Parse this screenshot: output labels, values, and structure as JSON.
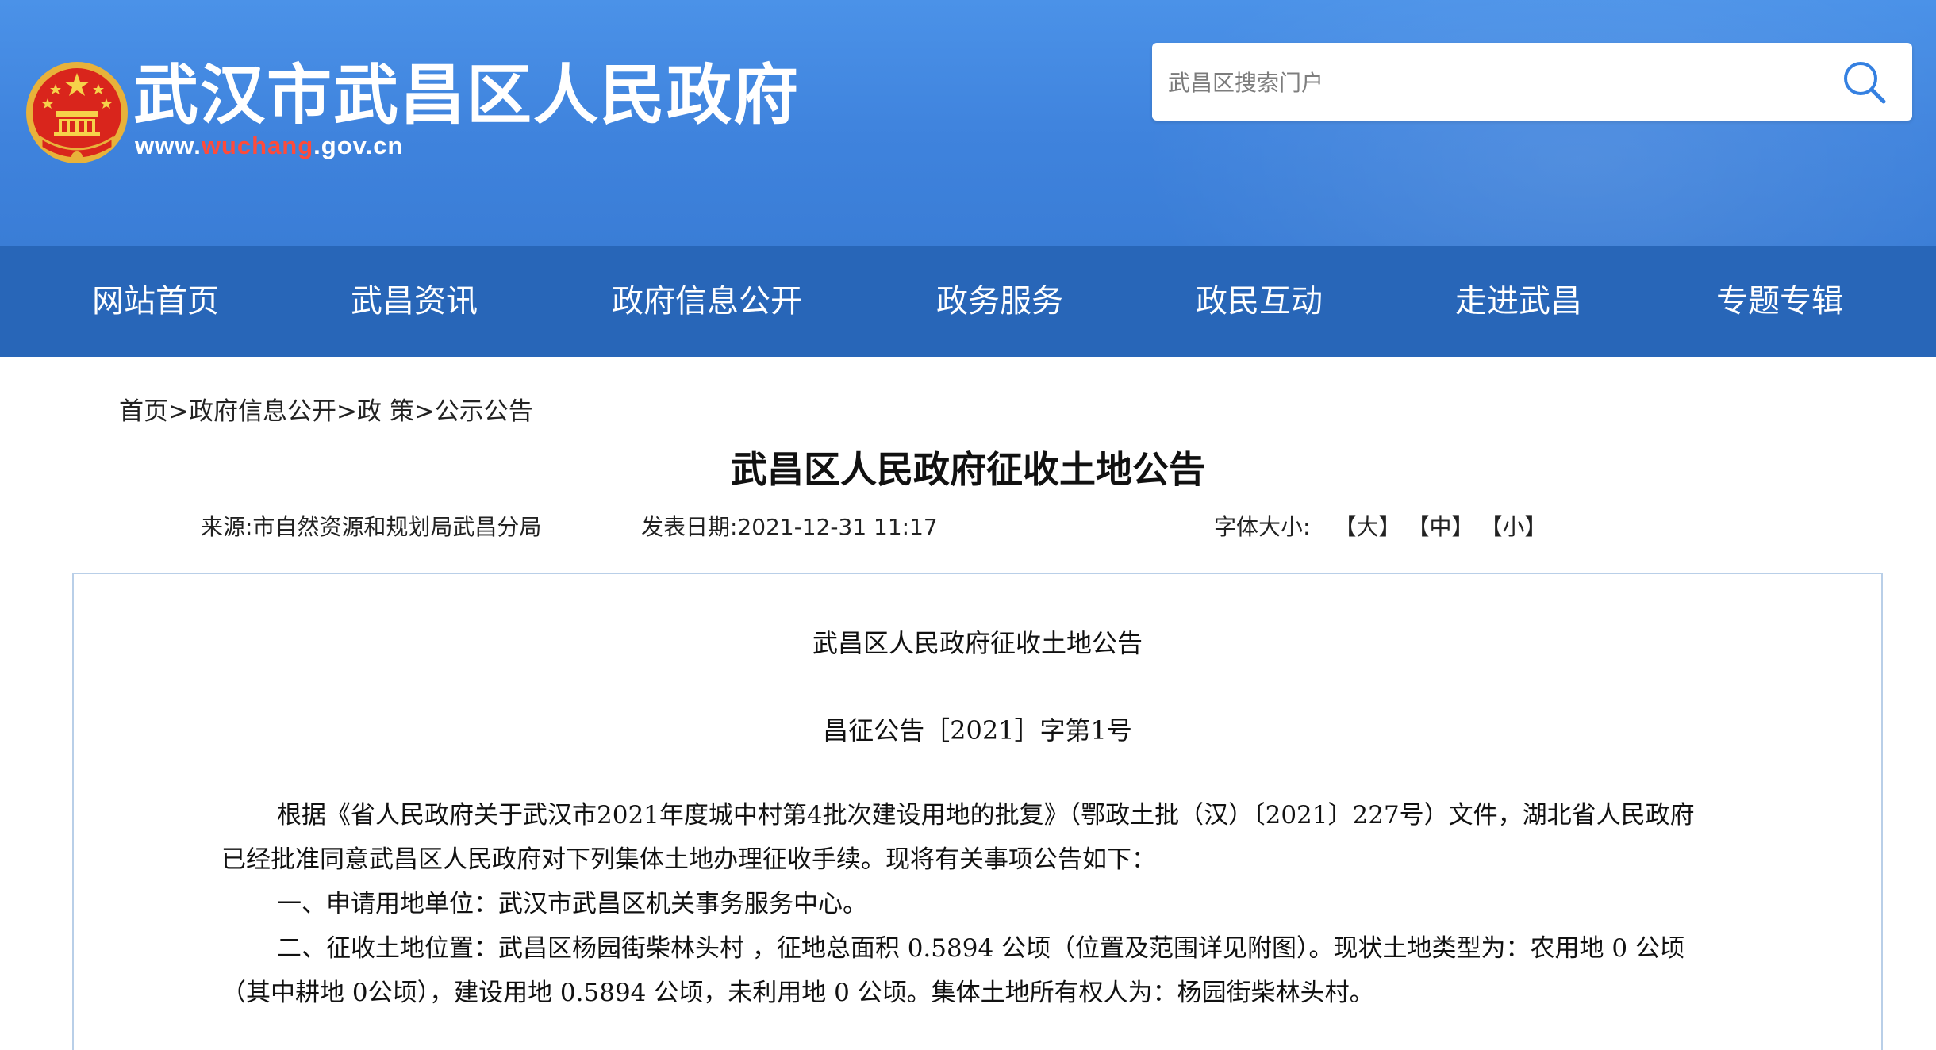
{
  "header": {
    "site_title": "武汉市武昌区人民政府",
    "url_prefix": "www.",
    "url_highlight": "wuchang",
    "url_suffix": ".gov.cn",
    "search_placeholder": "武昌区搜索门户",
    "colors": {
      "banner": "#3f83dd",
      "nav": "#2866b8",
      "url_accent": "#ff4b3a"
    }
  },
  "nav": {
    "items": [
      "网站首页",
      "武昌资讯",
      "政府信息公开",
      "政务服务",
      "政民互动",
      "走进武昌",
      "专题专辑"
    ]
  },
  "breadcrumb": {
    "items": [
      "首页",
      "政府信息公开",
      "政 策",
      "公示公告"
    ],
    "separator": ">"
  },
  "article": {
    "title": "武昌区人民政府征收土地公告",
    "source": "来源:市自然资源和规划局武昌分局",
    "date": "发表日期:2021-12-31 11:17",
    "font_size_label": "字体大小:",
    "font_sizes": [
      "【大】",
      "【中】",
      "【小】"
    ]
  },
  "document": {
    "title": "武昌区人民政府征收土地公告",
    "number": "昌征公告［2021］字第1号",
    "lines": [
      "根据《省人民政府关于武汉市2021年度城中村第4批次建设用地的批复》（鄂政土批（汉）〔2021〕227号）文件，湖北省人民政府",
      "已经批准同意武昌区人民政府对下列集体土地办理征收手续。现将有关事项公告如下：",
      "一、申请用地单位：武汉市武昌区机关事务服务中心。",
      "二、征收土地位置：武昌区杨园街柴林头村 ，征地总面积 0.5894 公顷（位置及范围详见附图）。现状土地类型为：农用地 0 公顷",
      "（其中耕地 0公顷），建设用地 0.5894 公顷，未利用地 0 公顷。集体土地所有权人为：杨园街柴林头村。"
    ]
  }
}
